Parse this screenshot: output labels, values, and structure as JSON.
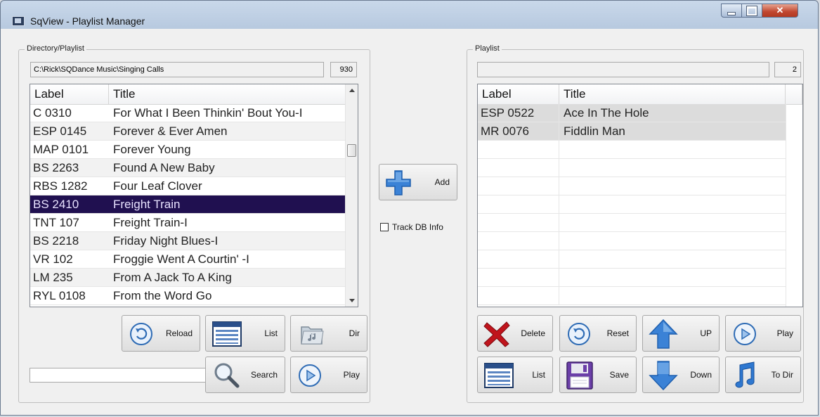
{
  "window": {
    "title": "SqView - Playlist Manager"
  },
  "directory": {
    "legend": "Directory/Playlist",
    "path": "C:\\Rick\\SQDance Music\\Singing Calls",
    "count": "930",
    "columns": [
      "Label",
      "Title"
    ],
    "rows": [
      {
        "label": "C 0310",
        "title": "For What I Been Thinkin' Bout You-I"
      },
      {
        "label": "ESP 0145",
        "title": "Forever & Ever Amen"
      },
      {
        "label": "MAP 0101",
        "title": "Forever Young"
      },
      {
        "label": "BS 2263",
        "title": "Found A New Baby"
      },
      {
        "label": "RBS 1282",
        "title": "Four Leaf Clover"
      },
      {
        "label": "BS 2410",
        "title": "Freight Train"
      },
      {
        "label": "TNT 107",
        "title": "Freight Train-I"
      },
      {
        "label": "BS 2218",
        "title": "Friday Night Blues-I"
      },
      {
        "label": "VR 102",
        "title": "Froggie Went A Courtin' -I"
      },
      {
        "label": "LM 235",
        "title": "From A Jack To A King"
      },
      {
        "label": "RYL 0108",
        "title": "From the Word Go"
      }
    ],
    "selected_label": "BS 2410",
    "buttons": {
      "reload": "Reload",
      "list": "List",
      "dir": "Dir",
      "search": "Search",
      "play": "Play"
    },
    "search_value": ""
  },
  "middle": {
    "add": "Add",
    "track_db_info": "Track DB Info",
    "track_db_checked": false
  },
  "playlist": {
    "legend": "Playlist",
    "name": "",
    "count": "2",
    "columns": [
      "Label",
      "Title"
    ],
    "rows": [
      {
        "label": "ESP 0522",
        "title": "Ace In The Hole"
      },
      {
        "label": "MR 0076",
        "title": "Fiddlin Man"
      }
    ],
    "buttons": {
      "delete": "Delete",
      "reset": "Reset",
      "up": "UP",
      "play": "Play",
      "list": "List",
      "save": "Save",
      "down": "Down",
      "to_dir": "To Dir"
    }
  },
  "colors": {
    "selection": "#201050",
    "accent_blue": "#3b82d6",
    "delete_red": "#c0141c"
  },
  "icons": {
    "reload": "reload-icon",
    "list": "list-icon",
    "dir": "folder-music-icon",
    "search": "magnifier-icon",
    "play": "play-icon",
    "add": "plus-icon",
    "delete": "x-icon",
    "reset": "reset-icon",
    "up": "arrow-up-icon",
    "down": "arrow-down-icon",
    "save": "floppy-icon",
    "to_dir": "music-note-icon"
  }
}
